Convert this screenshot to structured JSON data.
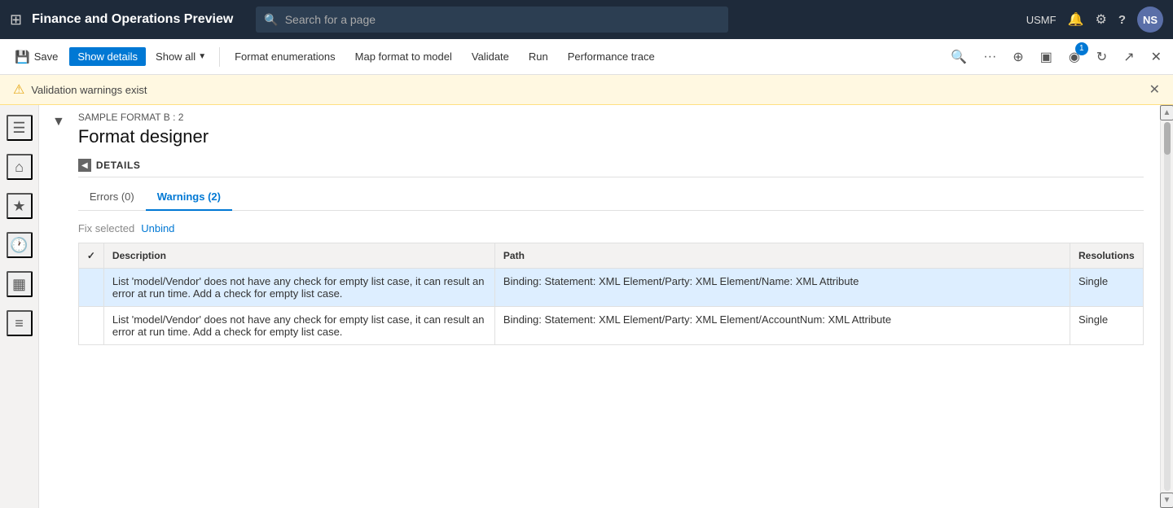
{
  "topnav": {
    "title": "Finance and Operations Preview",
    "search_placeholder": "Search for a page",
    "username": "USMF",
    "avatar_initials": "NS"
  },
  "toolbar": {
    "save_label": "Save",
    "show_details_label": "Show details",
    "show_all_label": "Show all",
    "format_enumerations_label": "Format enumerations",
    "map_format_label": "Map format to model",
    "validate_label": "Validate",
    "run_label": "Run",
    "performance_trace_label": "Performance trace",
    "badge_count": "1"
  },
  "warning": {
    "text": "Validation warnings exist"
  },
  "format_designer": {
    "sample_label": "SAMPLE FORMAT B : 2",
    "title": "Format designer",
    "details_label": "DETAILS",
    "tabs": [
      {
        "label": "Errors (0)",
        "active": false
      },
      {
        "label": "Warnings (2)",
        "active": true
      }
    ],
    "fix_selected_label": "Fix selected",
    "unbind_label": "Unbind",
    "table": {
      "columns": [
        "",
        "Description",
        "Path",
        "Resolutions"
      ],
      "rows": [
        {
          "selected": true,
          "description": "List 'model/Vendor' does not have any check for empty list case, it can result an error at run time. Add a check for empty list case.",
          "path": "Binding: Statement: XML Element/Party: XML Element/Name: XML Attribute",
          "resolution": "Single"
        },
        {
          "selected": false,
          "description": "List 'model/Vendor' does not have any check for empty list case, it can result an error at run time. Add a check for empty list case.",
          "path": "Binding: Statement: XML Element/Party: XML Element/AccountNum: XML Attribute",
          "resolution": "Single"
        }
      ]
    }
  },
  "icons": {
    "grid": "⊞",
    "search": "🔍",
    "bell": "🔔",
    "settings": "⚙",
    "help": "?",
    "home": "⌂",
    "star": "★",
    "clock": "🕐",
    "table": "▦",
    "list": "≡",
    "filter": "▼",
    "arrow_down": "▼",
    "more": "···",
    "puzzle": "⊕",
    "layout": "▣",
    "refresh": "↻",
    "share": "↗",
    "close": "✕",
    "warning": "⚠",
    "chevron_right": "▶",
    "chevron_down": "▼",
    "collapse": "◀"
  }
}
